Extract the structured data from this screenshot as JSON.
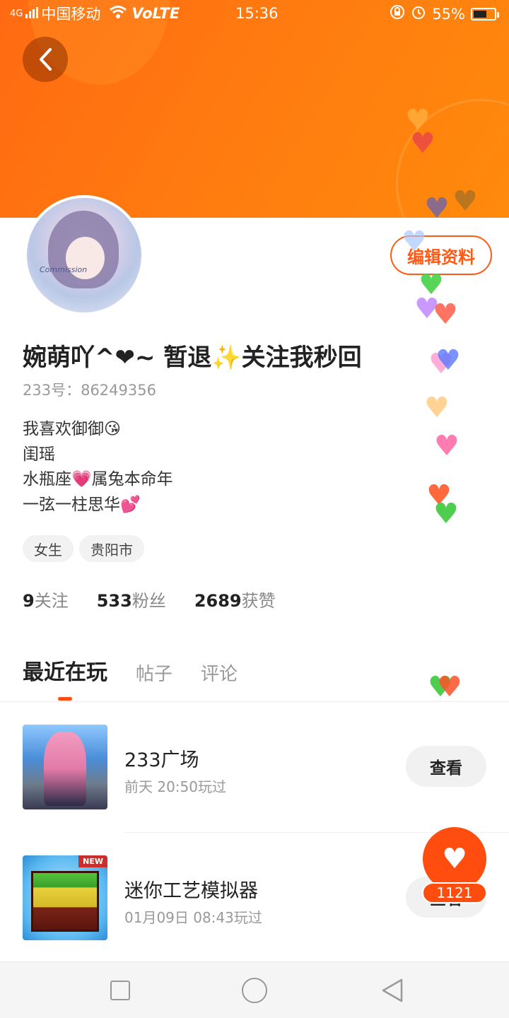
{
  "status_bar": {
    "signal": "4G",
    "carrier": "中国移动",
    "volte": "VoLTE",
    "time": "15:36",
    "battery": "55%"
  },
  "profile": {
    "avatar_text": "Commission",
    "name": "婉萌吖^❤~ 暂退✨关注我秒回",
    "uid": "233号：86249356",
    "edit_label": "编辑资料",
    "bio": [
      "我喜欢御御😘",
      "闺瑶",
      "水瓶座💗属兔本命年",
      "一弦一柱思华💕"
    ],
    "tags": [
      "女生",
      "贵阳市"
    ],
    "stats": {
      "following_count": "9",
      "following_label": "关注",
      "fans_count": "533",
      "fans_label": "粉丝",
      "likes_count": "2689",
      "likes_label": "获赞"
    }
  },
  "tabs": [
    "最近在玩",
    "帖子",
    "评论"
  ],
  "games": [
    {
      "title": "233广场",
      "played": "前天 20:50玩过",
      "button": "查看"
    },
    {
      "title": "迷你工艺模拟器",
      "played": "01月09日 08:43玩过",
      "button": "查看",
      "badge": "NEW"
    }
  ],
  "like": {
    "count": "1121"
  },
  "colors": {
    "accent": "#ff4d0f",
    "banner": "#ff7a10"
  }
}
